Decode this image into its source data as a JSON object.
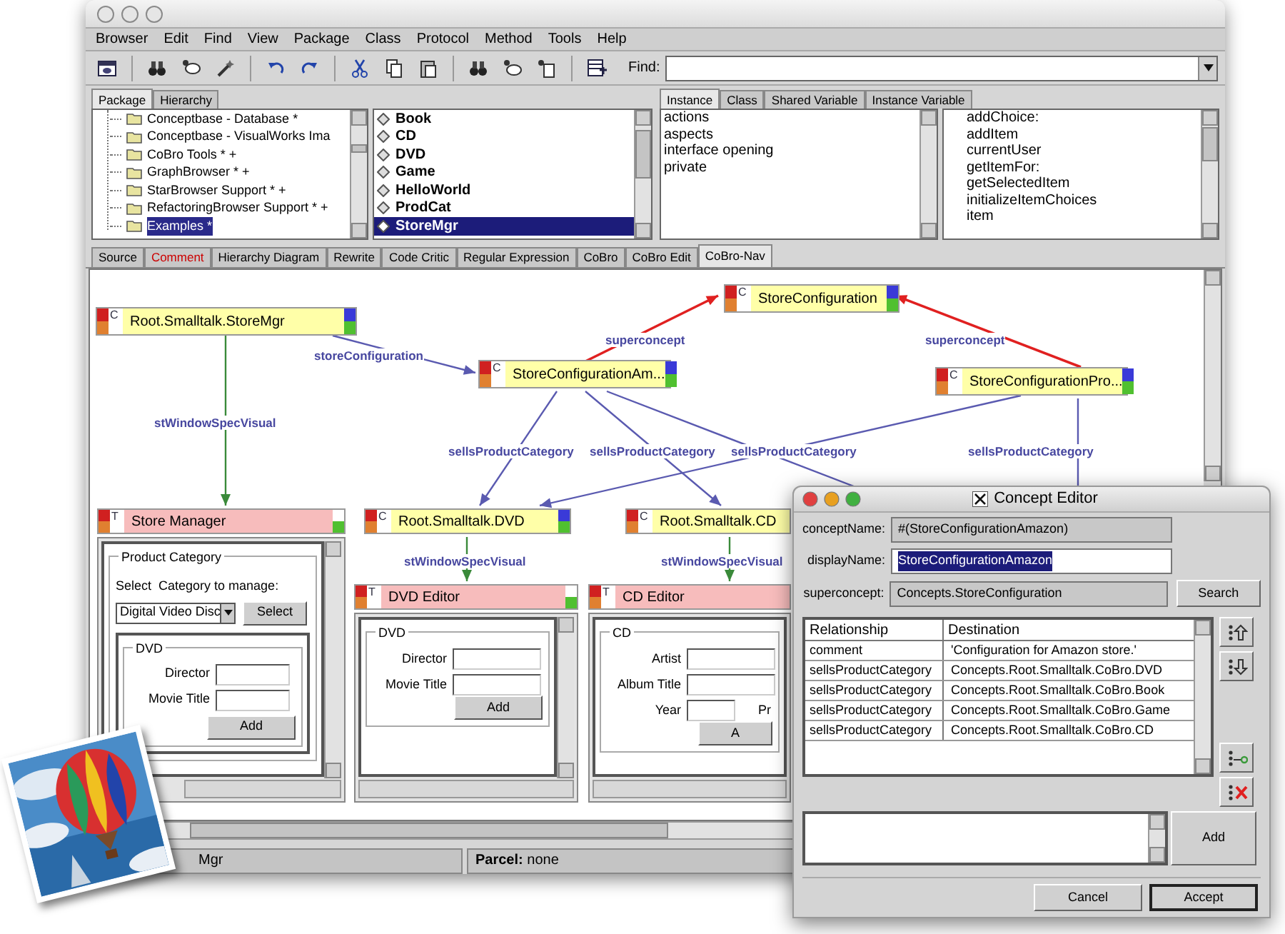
{
  "main_window": {
    "menu": [
      "Browser",
      "Edit",
      "Find",
      "View",
      "Package",
      "Class",
      "Protocol",
      "Method",
      "Tools",
      "Help"
    ],
    "find_label": "Find:"
  },
  "package_tabs": [
    {
      "label": "Package",
      "selected": true
    },
    {
      "label": "Hierarchy",
      "selected": false
    }
  ],
  "packages": [
    {
      "label": "Conceptbase - Database *",
      "selected": false
    },
    {
      "label": "Conceptbase - VisualWorks Ima",
      "selected": false
    },
    {
      "label": "CoBro Tools * +",
      "selected": false
    },
    {
      "label": "GraphBrowser * +",
      "selected": false
    },
    {
      "label": "StarBrowser Support * +",
      "selected": false
    },
    {
      "label": "RefactoringBrowser Support * +",
      "selected": false
    },
    {
      "label": "Examples *",
      "selected": true
    }
  ],
  "classes": [
    {
      "label": "Book",
      "selected": false
    },
    {
      "label": "CD",
      "selected": false
    },
    {
      "label": "DVD",
      "selected": false
    },
    {
      "label": "Game",
      "selected": false
    },
    {
      "label": "HelloWorld",
      "selected": false
    },
    {
      "label": "ProdCat",
      "selected": false
    },
    {
      "label": "StoreMgr",
      "selected": true
    }
  ],
  "protocol_tabs": [
    {
      "label": "Instance",
      "selected": true
    },
    {
      "label": "Class",
      "selected": false
    },
    {
      "label": "Shared Variable",
      "selected": false
    },
    {
      "label": "Instance Variable",
      "selected": false
    }
  ],
  "protocols": [
    "actions",
    "aspects",
    "interface opening",
    "private"
  ],
  "methods": [
    "addChoice:",
    "addItem",
    "currentUser",
    "getItemFor:",
    "getSelectedItem",
    "initializeItemChoices",
    "item"
  ],
  "code_tabs": [
    {
      "label": "Source",
      "selected": false,
      "color": "#000000"
    },
    {
      "label": "Comment",
      "selected": false,
      "color": "#cc0000"
    },
    {
      "label": "Hierarchy Diagram",
      "selected": false,
      "color": "#000000"
    },
    {
      "label": "Rewrite",
      "selected": false,
      "color": "#000000"
    },
    {
      "label": "Code Critic",
      "selected": false,
      "color": "#000000"
    },
    {
      "label": "Regular Expression",
      "selected": false,
      "color": "#000000"
    },
    {
      "label": "CoBro",
      "selected": false,
      "color": "#000000"
    },
    {
      "label": "CoBro Edit",
      "selected": false,
      "color": "#000000"
    },
    {
      "label": "CoBro-Nav",
      "selected": true,
      "color": "#000000"
    }
  ],
  "diagram": {
    "nodes": [
      {
        "kind": "concept",
        "letter": "C",
        "label": "Root.Smalltalk.StoreMgr"
      },
      {
        "kind": "concept",
        "letter": "C",
        "label": "StoreConfiguration"
      },
      {
        "kind": "concept",
        "letter": "C",
        "label": "StoreConfigurationAm..."
      },
      {
        "kind": "concept",
        "letter": "C",
        "label": "StoreConfigurationPro..."
      },
      {
        "kind": "template",
        "letter": "T",
        "label": "Store Manager"
      },
      {
        "kind": "concept",
        "letter": "C",
        "label": "Root.Smalltalk.DVD"
      },
      {
        "kind": "concept",
        "letter": "C",
        "label": "Root.Smalltalk.CD"
      },
      {
        "kind": "template",
        "letter": "T",
        "label": "DVD Editor"
      },
      {
        "kind": "template",
        "letter": "T",
        "label": "CD Editor"
      }
    ],
    "edges": [
      {
        "kind": "relation",
        "label": "storeConfiguration"
      },
      {
        "kind": "superconcept",
        "label": "superconcept"
      },
      {
        "kind": "superconcept",
        "label": "superconcept"
      },
      {
        "kind": "spec",
        "label": "stWindowSpecVisual"
      },
      {
        "kind": "relation",
        "label": "sellsProductCategory"
      },
      {
        "kind": "relation",
        "label": "sellsProductCategory"
      },
      {
        "kind": "relation"
      },
      {
        "kind": "relation",
        "label": "sellsProductCategory"
      },
      {
        "kind": "relation",
        "label": "sellsProductCategory"
      },
      {
        "kind": "spec",
        "label": "stWindowSpecVisual"
      },
      {
        "kind": "spec",
        "label": "stWindowSpecVisual"
      }
    ],
    "panels": [
      {
        "title": "Product Category",
        "prompt": "Select  Category to manage:",
        "choice": "Digital Video Disc",
        "select_button": "Select",
        "group": "DVD",
        "fields": [
          "Director",
          "Movie Title"
        ],
        "button": "Add"
      },
      {
        "group": "DVD",
        "fields": [
          "Director",
          "Movie Title"
        ],
        "button": "Add"
      },
      {
        "group": "CD",
        "fields": [
          "Artist",
          "Album Title",
          "Year"
        ],
        "extra_label": "Pr",
        "button": "A"
      }
    ]
  },
  "status_bar": {
    "left": "Mgr",
    "right": "**Parcel:** none"
  },
  "concept_editor": {
    "title": "Concept Editor",
    "fields": [
      {
        "label": "conceptName:",
        "value": "#(StoreConfigurationAmazon)",
        "editable": false,
        "text_selected": false
      },
      {
        "label": "displayName:",
        "value": "StoreConfigurationAmazon",
        "editable": true,
        "text_selected": true
      },
      {
        "label": "superconcept:",
        "value": "Concepts.StoreConfiguration",
        "editable": false,
        "text_selected": false
      }
    ],
    "search_button": "Search",
    "columns": [
      "Relationship",
      "Destination"
    ],
    "rows": [
      [
        "comment",
        "'Configuration for Amazon store.'"
      ],
      [
        "sellsProductCategory",
        "Concepts.Root.Smalltalk.CoBro.DVD"
      ],
      [
        "sellsProductCategory",
        "Concepts.Root.Smalltalk.CoBro.Book"
      ],
      [
        "sellsProductCategory",
        "Concepts.Root.Smalltalk.CoBro.Game"
      ],
      [
        "sellsProductCategory",
        "Concepts.Root.Smalltalk.CoBro.CD"
      ]
    ],
    "add_button": "Add",
    "buttons": [
      {
        "label": "Cancel",
        "default": false
      },
      {
        "label": "Accept",
        "default": true
      }
    ]
  }
}
